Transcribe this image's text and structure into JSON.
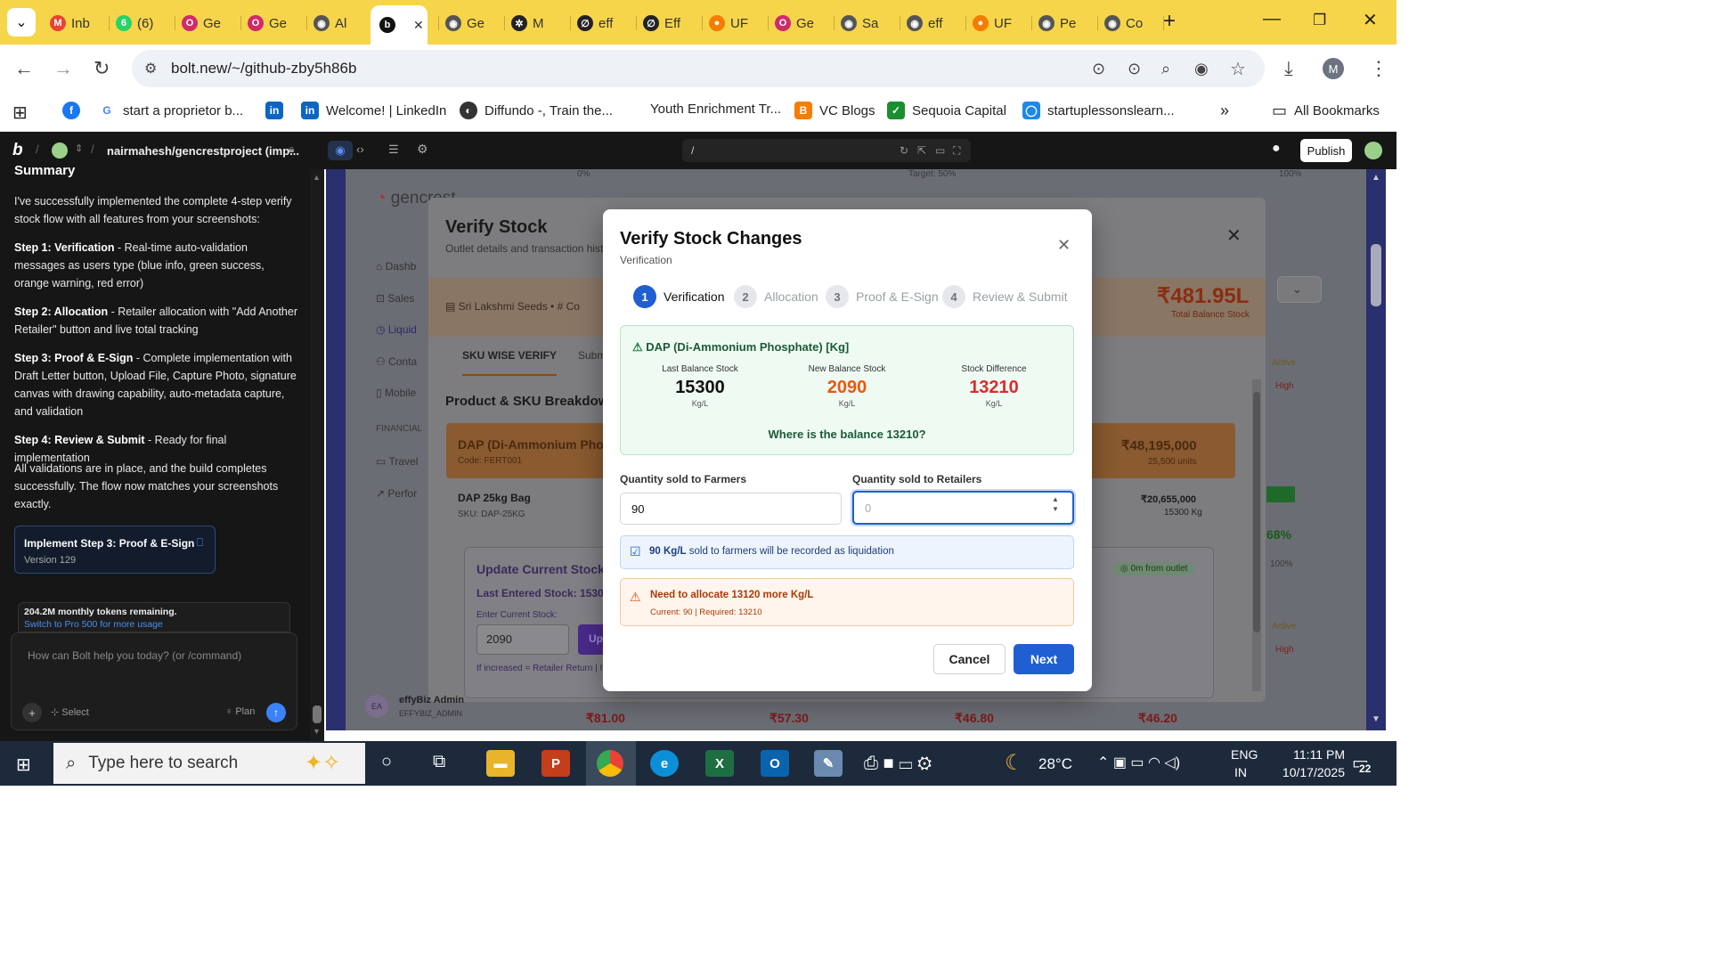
{
  "browser": {
    "tabs": [
      {
        "label": "Inb",
        "icon": "gmail-icon"
      },
      {
        "label": "(6)",
        "icon": "whatsapp-icon"
      },
      {
        "label": "Ge",
        "icon": "gencrest-icon"
      },
      {
        "label": "Ge",
        "icon": "gencrest-icon"
      },
      {
        "label": "Al",
        "icon": "globe-icon"
      },
      {
        "label": "",
        "icon": "bolt-icon"
      },
      {
        "label": "Ge",
        "icon": "globe-icon"
      },
      {
        "label": "M",
        "icon": "openai-icon"
      },
      {
        "label": "eff",
        "icon": "effy-icon"
      },
      {
        "label": "Eff",
        "icon": "effy-icon"
      },
      {
        "label": "UF",
        "icon": "uf-icon"
      },
      {
        "label": "Ge",
        "icon": "gencrest-icon"
      },
      {
        "label": "Sa",
        "icon": "globe-icon"
      },
      {
        "label": "eff",
        "icon": "globe-icon"
      },
      {
        "label": "UF",
        "icon": "uf-icon"
      },
      {
        "label": "Pe",
        "icon": "globe-icon"
      },
      {
        "label": "Co",
        "icon": "globe-icon"
      }
    ],
    "url": "bolt.new/~/github-zby5h86b",
    "bookmarks": [
      {
        "label": "start a proprietor b...",
        "icon": "google-icon"
      },
      {
        "label": "",
        "icon": "linkedin-icon"
      },
      {
        "label": "Welcome! | LinkedIn",
        "icon": "linkedin-icon"
      },
      {
        "label": "Diffundo -, Train the...",
        "icon": "globe-icon"
      },
      {
        "label": "Youth Enrichment Tr...",
        "icon": ""
      },
      {
        "label": "VC Blogs",
        "icon": "blogger-icon"
      },
      {
        "label": "Sequoia Capital",
        "icon": "sequoia-icon"
      },
      {
        "label": "startuplessonslearn...",
        "icon": "blog-icon"
      }
    ],
    "all_bookmarks": "All Bookmarks",
    "profile_initial": "M"
  },
  "app": {
    "project": "nairmahesh/gencrestproject (imp...",
    "path": "/",
    "publish": "Publish"
  },
  "chat": {
    "heading_partial": "Summary",
    "intro": "I've successfully implemented the complete 4-step verify stock flow with all features from your screenshots:",
    "steps": [
      {
        "title": "Step 1: Verification",
        "text": " - Real-time auto-validation messages as users type (blue info, green success, orange warning, red error)"
      },
      {
        "title": "Step 2: Allocation",
        "text": " - Retailer allocation with \"Add Another Retailer\" button and live total tracking"
      },
      {
        "title": "Step 3: Proof & E-Sign",
        "text": " - Complete implementation with Draft Letter button, Upload File, Capture Photo, signature canvas with drawing capability, auto-metadata capture, and validation"
      },
      {
        "title": "Step 4: Review & Submit",
        "text": " - Ready for final implementation"
      }
    ],
    "outro": "All validations are in place, and the build completes successfully. The flow now matches your screenshots exactly.",
    "version_card": {
      "title": "Implement Step 3: Proof & E-Sign",
      "version": "Version 129"
    },
    "tokens": "204.2M monthly tokens remaining.",
    "upgrade": "Switch to Pro 500 for more usage",
    "input_placeholder": "How can Bolt help you today? (or /command)",
    "select": "Select",
    "plan": "Plan"
  },
  "background": {
    "progress_left": "0%",
    "progress_target": "Target: 50%",
    "progress_right": "100%",
    "brand": "gencrest",
    "sidebar": [
      "Dashb",
      "Sales",
      "Liquid",
      "Conta",
      "Mobile"
    ],
    "sidebar_section": "FINANCIAL",
    "sidebar2": [
      "Travel",
      "Perfor"
    ],
    "verify_title": "Verify Stock",
    "verify_sub": "Outlet details and transaction histo",
    "outlet": "Sri Lakshmi Seeds",
    "code_partial": "Co",
    "balance": "₹481.95L",
    "balance_label": "Total Balance Stock",
    "tab_sku": "SKU WISE VERIFY",
    "tab_sub": "Subm",
    "breakdown": "Product & SKU Breakdown",
    "product": "DAP (Di-Ammonium Phosph",
    "product_code": "Code: FERT001",
    "product_value": "₹48,195,000",
    "product_units": "25,500 units",
    "sku": "DAP 25kg Bag",
    "sku_code": "SKU: DAP-25KG",
    "sku_value": "₹20,655,000",
    "sku_stock": "15300 Kg",
    "update_title": "Update Current Stock",
    "last_entered": "Last Entered Stock: 15300 Kg",
    "enter_label": "Enter Current Stock:",
    "enter_value": "2090",
    "update_btn": "Up",
    "note": "If increased = Retailer Return | If d",
    "distance": "0m from outlet",
    "active": "Active",
    "high": "High",
    "pct68": "68%",
    "pct100": "100%",
    "user": "effyBiz Admin",
    "user_role": "EFFYBIZ_ADMIN",
    "user_initials": "EA",
    "prices": [
      "₹81.00",
      "₹57.30",
      "₹46.80",
      "₹46.20"
    ]
  },
  "modal": {
    "title": "Verify Stock Changes",
    "subtitle": "Verification",
    "steps": [
      {
        "num": "1",
        "label": "Verification"
      },
      {
        "num": "2",
        "label": "Allocation"
      },
      {
        "num": "3",
        "label": "Proof & E-Sign"
      },
      {
        "num": "4",
        "label": "Review & Submit"
      }
    ],
    "product": "DAP (Di-Ammonium Phosphate) [Kg]",
    "stats": [
      {
        "label": "Last Balance Stock",
        "value": "15300",
        "unit": "Kg/L",
        "color": "#111111"
      },
      {
        "label": "New Balance Stock",
        "value": "2090",
        "unit": "Kg/L",
        "color": "#e8590c"
      },
      {
        "label": "Stock Difference",
        "value": "13210",
        "unit": "Kg/L",
        "color": "#d92d2d"
      }
    ],
    "question": "Where is the balance 13210?",
    "farmers_label": "Quantity sold to Farmers",
    "farmers_value": "90",
    "retailers_label": "Quantity sold to Retailers",
    "retailers_placeholder": "0",
    "info_strong": "90 Kg/L",
    "info_text": " sold to farmers will be recorded as liquidation",
    "warn_title": "Need to allocate 13120 more Kg/L",
    "warn_detail": "Current: 90 | Required: 13210",
    "cancel": "Cancel",
    "next": "Next"
  },
  "taskbar": {
    "search": "Type here to search",
    "temp": "28°C",
    "lang1": "ENG",
    "lang2": "IN",
    "time": "11:11 PM",
    "date": "10/17/2025",
    "notif": "22"
  }
}
